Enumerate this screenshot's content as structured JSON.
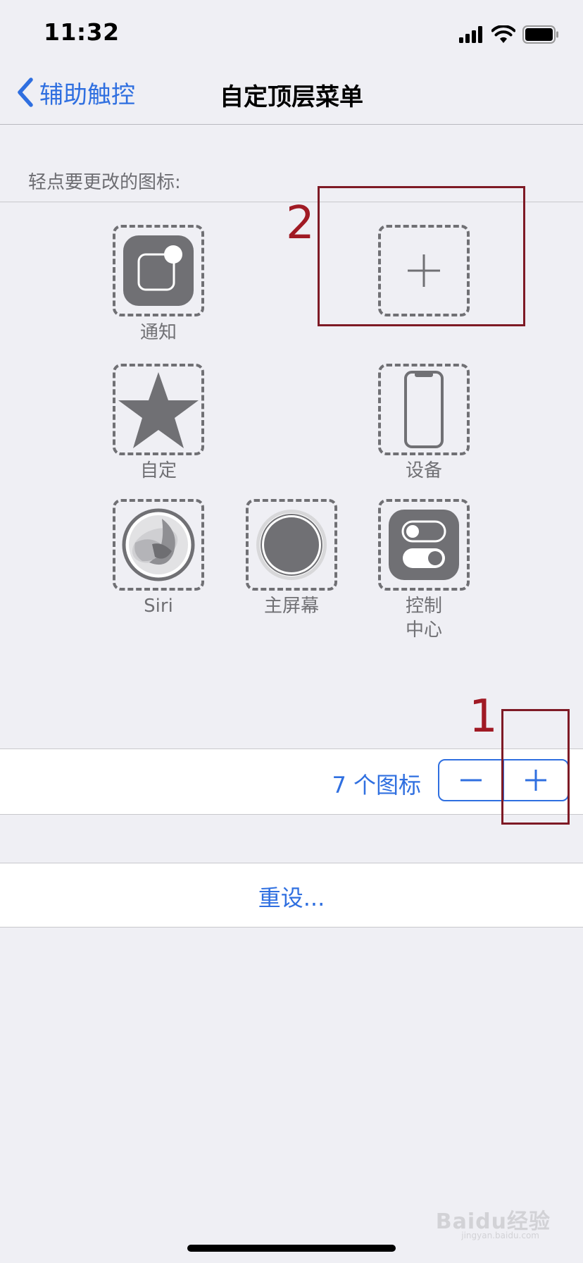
{
  "status_bar": {
    "time": "11:32"
  },
  "nav": {
    "back_label": "辅助触控",
    "title": "自定顶层菜单"
  },
  "section_header": "轻点要更改的图标:",
  "icons": {
    "notification": "通知",
    "custom": "自定",
    "device": "设备",
    "siri": "Siri",
    "home": "主屏幕",
    "control_center_line1": "控制",
    "control_center_line2": "中心"
  },
  "annotations": {
    "box1_number": "1",
    "box2_number": "2"
  },
  "count_row": {
    "label": "7 个图标",
    "minus": "−",
    "plus": "+"
  },
  "reset": {
    "label": "重设..."
  },
  "watermark": {
    "text": "Baidu经验",
    "sub": "jingyan.baidu.com"
  },
  "colors": {
    "accent": "#2f6fe0",
    "annotation": "#a01a24",
    "icon_gray": "#707074",
    "background": "#efeff4"
  }
}
